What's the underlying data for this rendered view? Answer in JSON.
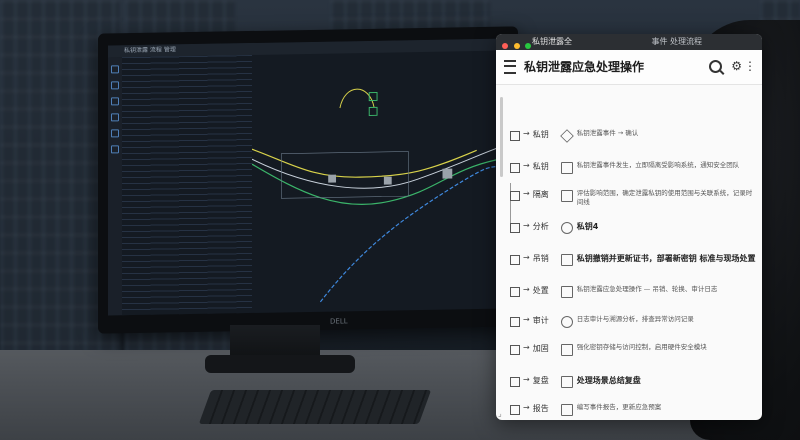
{
  "app": {
    "chrome_title": "私钥泄露全",
    "chrome_right": "事件 处理流程",
    "title": "私钥泄露应急处理操作",
    "icons": {
      "menu": "hamburger-icon",
      "search": "search-icon",
      "settings": "gear-icon",
      "more": "more-vertical-icon"
    }
  },
  "steps": [
    {
      "node": "私钥",
      "text": "私钥泄露事件 → 确认",
      "bold": false
    },
    {
      "node": "私钥",
      "text": "私钥泄露事件发生，立即隔离受影响系统，通知安全团队",
      "bold": false
    },
    {
      "node": "隔离",
      "text": "评估影响范围，确定泄露私钥的使用范围与关联系统，记录时间线",
      "bold": false
    },
    {
      "node": "分析",
      "text": "私钥4",
      "bold": true
    },
    {
      "node": "吊销",
      "text": "私钥撤销并更新证书，部署新密钥 标准与现场处置",
      "bold": true
    },
    {
      "node": "处置",
      "text": "私钥泄露应急处理操作 — 吊销、轮换、审计日志",
      "bold": false
    },
    {
      "node": "审计",
      "text": "日志审计与溯源分析，排查异常访问记录",
      "bold": false
    },
    {
      "node": "加固",
      "text": "强化密钥存储与访问控制，启用硬件安全模块",
      "bold": false
    },
    {
      "node": "复盘",
      "text": "处理场景总结复盘",
      "bold": true
    },
    {
      "node": "报告",
      "text": "编写事件报告，更新应急预案",
      "bold": false
    }
  ],
  "monitor": {
    "ide_title": "私钥泄露 流程 管理",
    "brand": "DELL"
  },
  "colors": {
    "accent_yellow": "#d8d24a",
    "accent_green": "#3bb56a",
    "accent_blue": "#3f8ae0"
  }
}
